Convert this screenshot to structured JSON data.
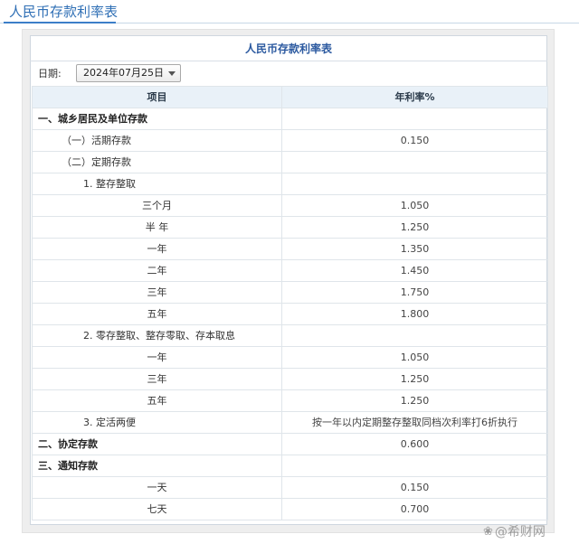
{
  "page": {
    "title": "人民币存款利率表"
  },
  "table": {
    "caption": "人民币存款利率表",
    "date_label": "日期:",
    "date_value": "2024年07月25日",
    "headers": [
      "项目",
      "年利率%"
    ],
    "rows": [
      {
        "item": "一、城乡居民及单位存款",
        "rate": "",
        "level": 0
      },
      {
        "item": "（一）活期存款",
        "rate": "0.150",
        "level": 1
      },
      {
        "item": "（二）定期存款",
        "rate": "",
        "level": 1
      },
      {
        "item": "1. 整存整取",
        "rate": "",
        "level": 2
      },
      {
        "item": "三个月",
        "rate": "1.050",
        "level": 3
      },
      {
        "item": "半 年",
        "rate": "1.250",
        "level": 3
      },
      {
        "item": "一年",
        "rate": "1.350",
        "level": 3
      },
      {
        "item": "二年",
        "rate": "1.450",
        "level": 3
      },
      {
        "item": "三年",
        "rate": "1.750",
        "level": 3
      },
      {
        "item": "五年",
        "rate": "1.800",
        "level": 3
      },
      {
        "item": "2. 零存整取、整存零取、存本取息",
        "rate": "",
        "level": 2
      },
      {
        "item": "一年",
        "rate": "1.050",
        "level": 3
      },
      {
        "item": "三年",
        "rate": "1.250",
        "level": 3
      },
      {
        "item": "五年",
        "rate": "1.250",
        "level": 3
      },
      {
        "item": "3. 定活两便",
        "rate": "按一年以内定期整存整取同档次利率打6折执行",
        "level": 2
      },
      {
        "item": "二、协定存款",
        "rate": "0.600",
        "level": 0
      },
      {
        "item": "三、通知存款",
        "rate": "",
        "level": 0
      },
      {
        "item": "一天",
        "rate": "0.150",
        "level": 3
      },
      {
        "item": "七天",
        "rate": "0.700",
        "level": 3
      }
    ]
  },
  "watermark": {
    "text": "@希财网",
    "icon": "paw-icon"
  },
  "colors": {
    "accent": "#2f6fb5",
    "header_bg": "#e9f1f8",
    "border": "#dfe5ea"
  }
}
